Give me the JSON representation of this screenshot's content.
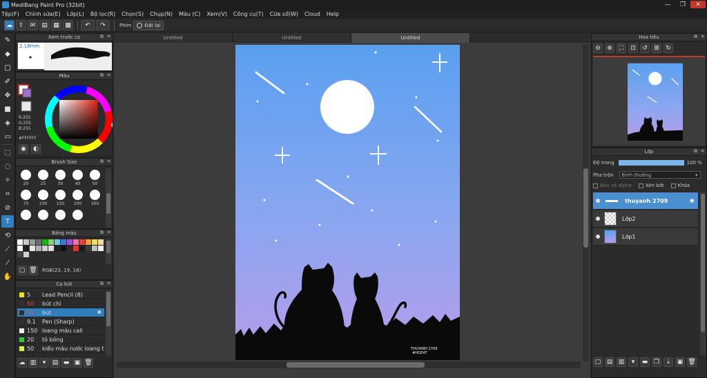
{
  "window": {
    "title": "MediBang Paint Pro (32bit)",
    "min": "—",
    "max": "❐",
    "close": "✕"
  },
  "menu": [
    "Tệp(F)",
    "Chỉnh sửa(E)",
    "Lớp(L)",
    "Bộ lọc(R)",
    "Chọn(S)",
    "Chụp(N)",
    "Màu (C)",
    "Xem(V)",
    "Công cụ(T)",
    "Cửa sổ(W)",
    "Cloud",
    "Help"
  ],
  "toolbar": {
    "hand_label": "Phím",
    "reset_label": "Đặt lại"
  },
  "brush_preview": {
    "title": "Xem trước cọ",
    "size": "2.18mm"
  },
  "color": {
    "title": "Màu",
    "r": "R:255",
    "g": "G:255",
    "b": "B:255",
    "hex": "#FFFFFF"
  },
  "brush_size": {
    "title": "Brush Size",
    "sizes": [
      "20",
      "25",
      "30",
      "40",
      "50",
      "70",
      "100",
      "150",
      "200",
      "300",
      "",
      "",
      ""
    ]
  },
  "palette": {
    "title": "Bảng màu",
    "rgb": "RGB(23, 19, 18)",
    "swatches": [
      "#ffffff",
      "#c8c8c8",
      "#9b9b9b",
      "#6e6e6e",
      "#00c000",
      "#8fd06e",
      "#6ec8f0",
      "#3c78dc",
      "#a050dc",
      "#e878a0",
      "#f03c3c",
      "#f0a03c",
      "#f0e03c",
      "#f8d8a0",
      "#ffffff",
      "#202020",
      "#e8e8e8",
      "#b0b0b0",
      "#d0d0d0",
      "#e0e0e0",
      "#202020",
      "#101010",
      "#2a2a2a",
      "#e83030",
      "#1a1a1a",
      "#3a3a3a",
      "#c0c0c0",
      "#f0f0f0",
      "#444444",
      "#d0d0d0"
    ]
  },
  "brushes": {
    "title": "Cọ bút",
    "items": [
      {
        "size": "5",
        "name": "Lead Pencil (8)",
        "color": "#f0e030"
      },
      {
        "size": "50",
        "name": "bút chì",
        "color": "#303030"
      },
      {
        "size": "30",
        "name": "bút",
        "color": "#2f7fbf"
      },
      {
        "size": "9.1",
        "name": "Pen (Sharp)",
        "color": "#303030"
      },
      {
        "size": "150",
        "name": "loang màu cali",
        "color": "#f0f0f0"
      },
      {
        "size": "20",
        "name": "tô bóng",
        "color": "#40c040"
      },
      {
        "size": "50",
        "name": "kiểu màu nước loang trên",
        "color": "#e0f050"
      }
    ]
  },
  "tabs": [
    "Untitled",
    "Untitled",
    "Untitled"
  ],
  "artwork": {
    "signature_line1": "THUYANH 2709",
    "signature_line2": "#HOZ4T",
    "sky_top": "#5aa0f0",
    "sky_bottom": "#b89cec"
  },
  "navigator": {
    "title": "Hoa tiêu"
  },
  "layers": {
    "title": "Lớp",
    "opacity_label": "Độ trong",
    "opacity_value": "100 %",
    "blend_label": "Pha trộn",
    "blend_value": "Bình thường",
    "protect_alpha": "Bảo vệ alpha",
    "clipping": "Xén bớt",
    "lock": "Khóa",
    "items": [
      {
        "name": "thuyanh 2709"
      },
      {
        "name": "Lớp2"
      },
      {
        "name": "Lớp1"
      }
    ]
  }
}
